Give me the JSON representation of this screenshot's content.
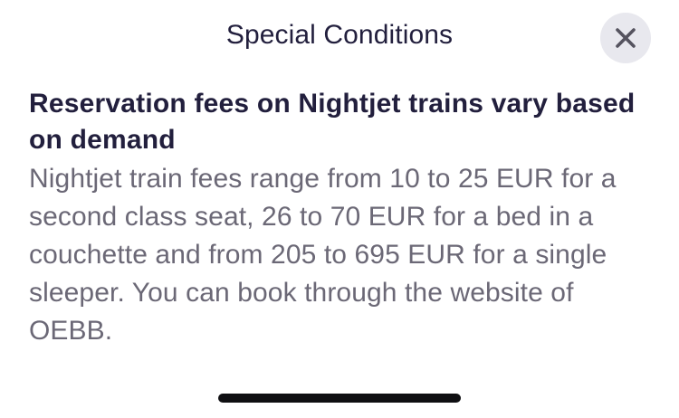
{
  "modal": {
    "title": "Special Conditions",
    "close_icon": "close-icon"
  },
  "content": {
    "heading": "Reservation fees on Nightjet trains vary based on demand",
    "body": "Nightjet train fees range from 10 to 25 EUR for a second class seat, 26 to 70 EUR for a bed in a couchette and from 205 to 695 EUR for a single sleeper. You can book through the website of OEBB."
  },
  "colors": {
    "title": "#221f3d",
    "body": "#6b6876",
    "close_bg": "#e8e8ee",
    "home_indicator": "#0f0f12"
  }
}
